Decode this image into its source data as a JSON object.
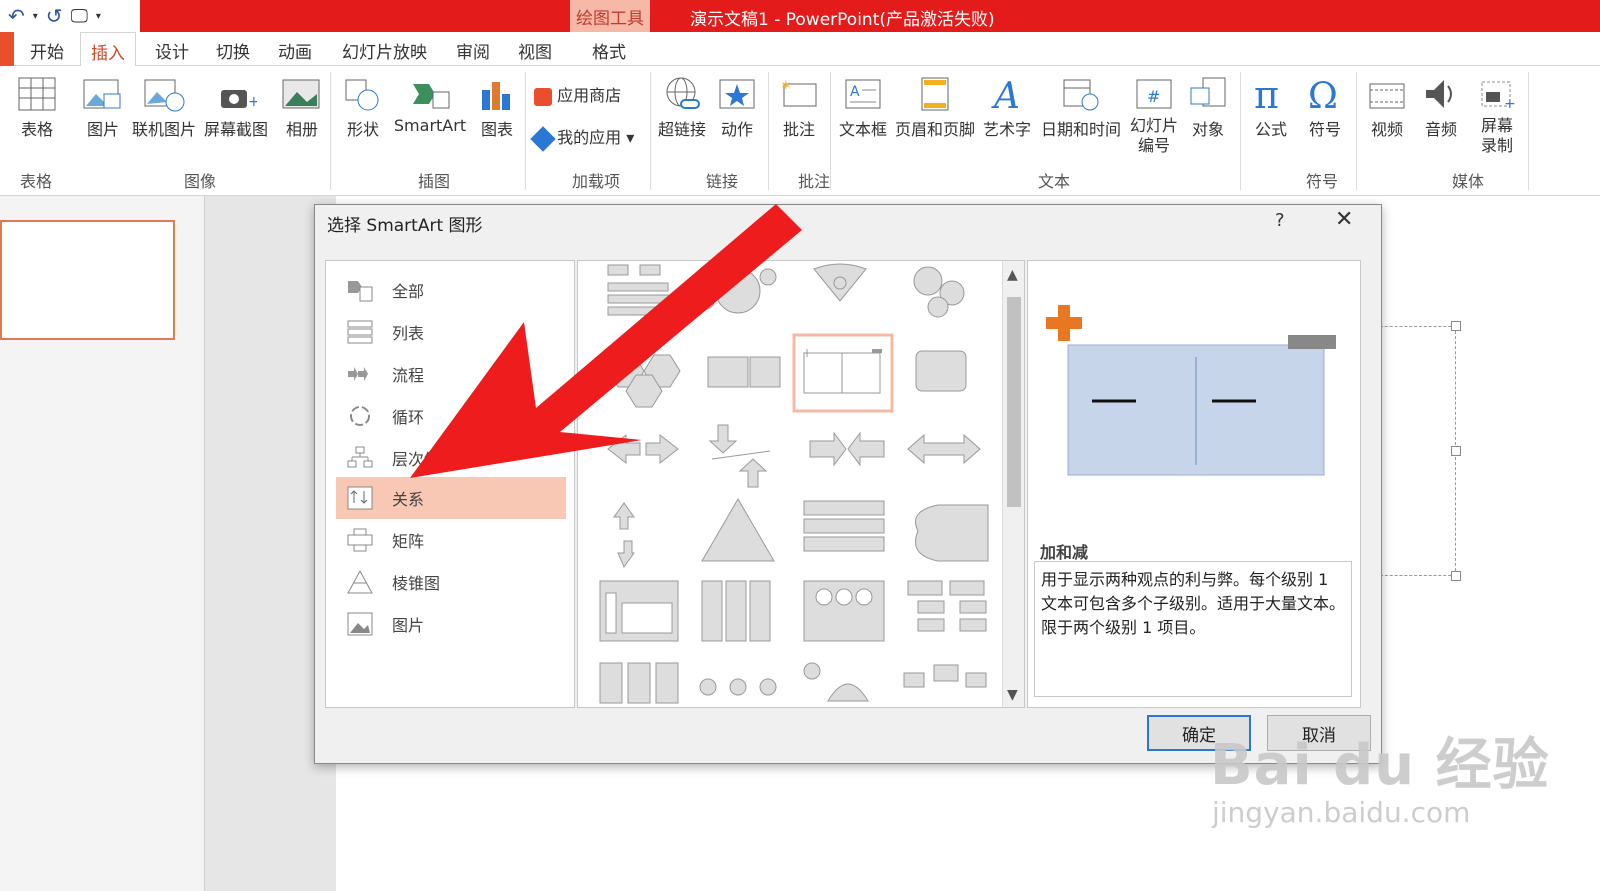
{
  "window": {
    "title": "演示文稿1 -  PowerPoint(产品激活失败)",
    "tool_tab": "绘图工具"
  },
  "menu": {
    "tabs": [
      "开始",
      "插入",
      "设计",
      "切换",
      "动画",
      "幻灯片放映",
      "审阅",
      "视图",
      "格式"
    ],
    "active": "插入"
  },
  "ribbon": {
    "table": "表格",
    "picture": "图片",
    "online_picture": "联机图片",
    "screenshot": "屏幕截图",
    "album": "相册",
    "shapes": "形状",
    "smartart": "SmartArt",
    "chart": "图表",
    "store": "应用商店",
    "my_apps": "我的应用",
    "hyperlink": "超链接",
    "action": "动作",
    "comment": "批注",
    "textbox": "文本框",
    "header_footer": "页眉和页脚",
    "wordart": "艺术字",
    "datetime": "日期和时间",
    "slide_number_1": "幻灯片",
    "slide_number_2": "编号",
    "object": "对象",
    "equation": "公式",
    "symbol": "符号",
    "video": "视频",
    "audio": "音频",
    "screen_rec_1": "屏幕",
    "screen_rec_2": "录制",
    "groups": {
      "tables": "表格",
      "images": "图像",
      "illustrations": "插图",
      "addins": "加载项",
      "links": "链接",
      "comments": "批注",
      "text": "文本",
      "symbols": "符号",
      "media": "媒体"
    }
  },
  "dialog": {
    "title": "选择 SmartArt 图形",
    "help": "?",
    "categories": [
      "全部",
      "列表",
      "流程",
      "循环",
      "层次结构",
      "关系",
      "矩阵",
      "棱锥图",
      "图片"
    ],
    "selected_category": "关系",
    "preview_name": "加和减",
    "preview_desc": "用于显示两种观点的利与弊。每个级别 1 文本可包含多个子级别。适用于大量文本。限于两个级别 1 项目。",
    "ok": "确定",
    "cancel": "取消"
  },
  "watermark": {
    "main": "Bai du 经验",
    "url": "jingyan.baidu.com"
  }
}
